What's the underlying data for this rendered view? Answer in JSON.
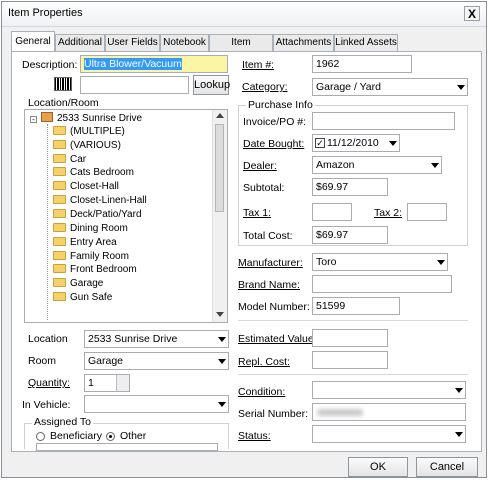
{
  "window": {
    "title": "Item Properties",
    "close_glyph": "X"
  },
  "tabs": [
    "General",
    "Additional",
    "User Fields",
    "Notebook",
    "Item Picture(s)",
    "Attachments",
    "Linked Assets"
  ],
  "left": {
    "description_label": "Description:",
    "description_value": "Ultra Blower/Vacuum",
    "lookup_label": "Lookup",
    "location_room_label": "Location/Room",
    "tree_root": "2533 Sunrise Drive",
    "tree_items": [
      "(MULTIPLE)",
      "(VARIOUS)",
      "Car",
      "Cats Bedroom",
      "Closet-Hall",
      "Closet-Linen-Hall",
      "Deck/Patio/Yard",
      "Dining Room",
      "Entry Area",
      "Family Room",
      "Front Bedroom",
      "Garage",
      "Gun Safe"
    ],
    "location_label": "Location",
    "location_value": "2533 Sunrise Drive",
    "room_label": "Room",
    "room_value": "Garage",
    "quantity_label": "Quantity:",
    "quantity_value": "1",
    "in_vehicle_label": "In Vehicle:",
    "assigned_to_label": "Assigned To",
    "beneficiary_label": "Beneficiary",
    "other_label": "Other"
  },
  "right": {
    "item_no_label": "Item #:",
    "item_no_value": "1962",
    "category_label": "Category:",
    "category_value": "Garage / Yard",
    "purchase_info_label": "Purchase Info",
    "invoice_label": "Invoice/PO #:",
    "date_bought_label": "Date Bought:",
    "date_bought_value": "11/12/2010",
    "dealer_label": "Dealer:",
    "dealer_value": "Amazon",
    "subtotal_label": "Subtotal:",
    "subtotal_value": "$69.97",
    "tax1_label": "Tax 1:",
    "tax2_label": "Tax 2:",
    "total_cost_label": "Total Cost:",
    "total_cost_value": "$69.97",
    "manufacturer_label": "Manufacturer:",
    "manufacturer_value": "Toro",
    "brand_name_label": "Brand Name:",
    "model_number_label": "Model Number:",
    "model_number_value": "51599",
    "estimated_value_label": "Estimated Value",
    "repl_cost_label": "Repl. Cost:",
    "condition_label": "Condition:",
    "serial_number_label": "Serial Number:",
    "status_label": "Status:"
  },
  "footer": {
    "ok_label": "OK",
    "cancel_label": "Cancel"
  }
}
